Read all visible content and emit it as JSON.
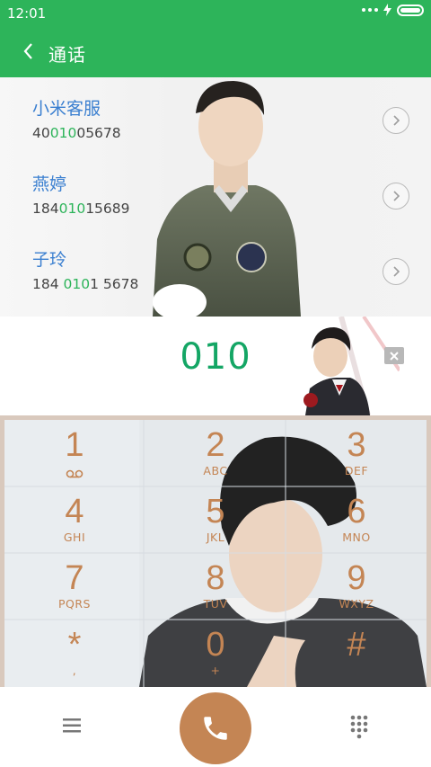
{
  "status": {
    "time": "12:01"
  },
  "header": {
    "title": "通话"
  },
  "results": [
    {
      "name": "小米客服",
      "num_pre": "40",
      "num_hl": "010",
      "num_post": "05678"
    },
    {
      "name": "燕婷",
      "num_pre": "184",
      "num_hl": "010",
      "num_post": "15689"
    },
    {
      "name": "子玲",
      "num_pre": "184 ",
      "num_hl": "010",
      "num_post": "1 5678"
    }
  ],
  "input": {
    "digits": "010"
  },
  "keys": [
    {
      "digit": "1",
      "letters": ""
    },
    {
      "digit": "2",
      "letters": "ABC"
    },
    {
      "digit": "3",
      "letters": "DEF"
    },
    {
      "digit": "4",
      "letters": "GHI"
    },
    {
      "digit": "5",
      "letters": "JKL"
    },
    {
      "digit": "6",
      "letters": "MNO"
    },
    {
      "digit": "7",
      "letters": "PQRS"
    },
    {
      "digit": "8",
      "letters": "TUV"
    },
    {
      "digit": "9",
      "letters": "WXYZ"
    },
    {
      "digit": "*",
      "letters": ","
    },
    {
      "digit": "0",
      "letters": "+"
    },
    {
      "digit": "#",
      "letters": ""
    }
  ],
  "icons": {
    "back": "chevron-left-icon",
    "voicemail": "voicemail-icon",
    "delete": "backspace-icon",
    "menu": "menu-icon",
    "call": "phone-icon",
    "dialpad": "dialpad-icon"
  },
  "colors": {
    "brand_green": "#2db45a",
    "digit_green": "#14a665",
    "name_blue": "#3a7fd0",
    "key_copper": "#c48554"
  }
}
